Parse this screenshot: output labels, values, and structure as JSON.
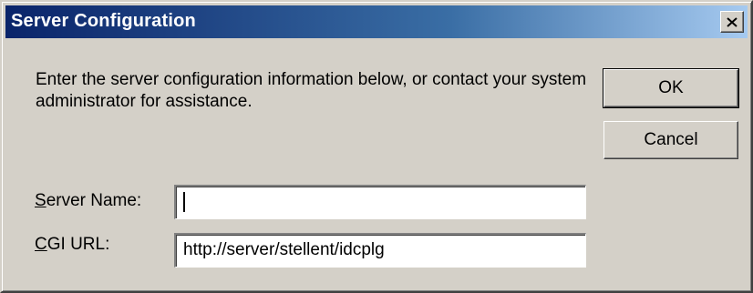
{
  "window": {
    "title": "Server Configuration",
    "close_icon": "close-icon"
  },
  "description": "Enter the server configuration information below, or contact your system administrator for assistance.",
  "buttons": {
    "ok_label": "OK",
    "cancel_label": "Cancel"
  },
  "fields": {
    "server_name": {
      "label_mnemonic": "S",
      "label_rest": "erver Name:",
      "value": ""
    },
    "cgi_url": {
      "label_mnemonic": "C",
      "label_rest": "GI URL:",
      "value": "http://server/stellent/idcplg"
    }
  },
  "colors": {
    "titlebar_start": "#0a246a",
    "titlebar_end": "#a6caf0",
    "dialog_bg": "#d4d0c8"
  }
}
